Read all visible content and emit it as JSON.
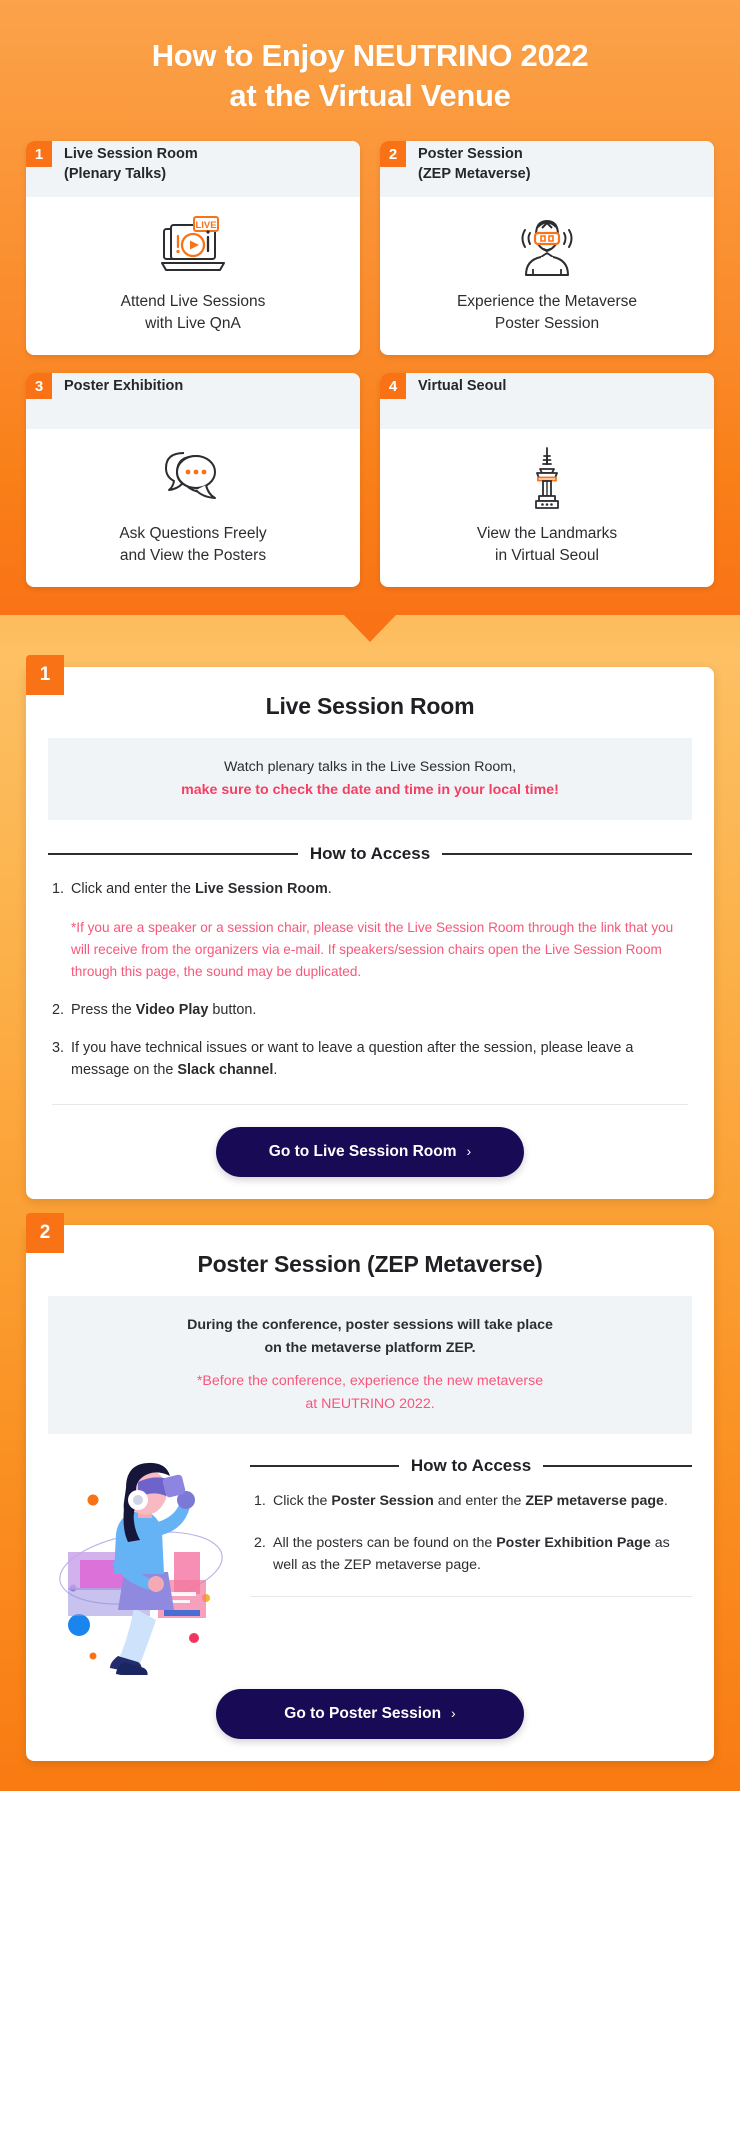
{
  "hero": {
    "title_lines": [
      "How to Enjoy NEUTRINO 2022",
      "at the Virtual Venue"
    ],
    "cards": [
      {
        "number": "1",
        "title_lines": [
          "Live Session Room",
          "(Plenary Talks)"
        ],
        "icon": "live-laptop-icon",
        "icon_label": "LIVE",
        "caption_lines": [
          "Attend Live Sessions",
          "with Live QnA"
        ]
      },
      {
        "number": "2",
        "title_lines": [
          "Poster Session",
          "(ZEP Metaverse)"
        ],
        "icon": "vr-headset-person-icon",
        "caption_lines": [
          "Experience the Metaverse",
          "Poster Session"
        ]
      },
      {
        "number": "3",
        "title_lines": [
          "Poster Exhibition"
        ],
        "icon": "chat-bubbles-icon",
        "caption_lines": [
          "Ask Questions Freely",
          "and View the Posters"
        ]
      },
      {
        "number": "4",
        "title_lines": [
          "Virtual Seoul"
        ],
        "icon": "seoul-tower-icon",
        "caption_lines": [
          "View the Landmarks",
          "in Virtual Seoul"
        ]
      }
    ]
  },
  "sections": [
    {
      "number": "1",
      "title": "Live Session Room",
      "notice": [
        {
          "text": "Watch plenary talks in the Live Session Room,",
          "style": "plain"
        },
        {
          "text": "make sure to check the date and time in your local time!",
          "style": "pink"
        }
      ],
      "how_to_access_label": "How to Access",
      "steps": [
        {
          "num": "1.",
          "parts": [
            {
              "t": "Click and enter the ",
              "b": false
            },
            {
              "t": "Live Session Room",
              "b": true
            },
            {
              "t": ".",
              "b": false
            }
          ],
          "note": "*If you are a speaker or a session chair, please visit the Live Session Room through the link that you will receive from the organizers via e-mail. If speakers/session chairs open the Live Session Room through this page, the sound may be duplicated."
        },
        {
          "num": "2.",
          "parts": [
            {
              "t": "Press the ",
              "b": false
            },
            {
              "t": "Video Play",
              "b": true
            },
            {
              "t": " button.",
              "b": false
            }
          ]
        },
        {
          "num": "3.",
          "parts": [
            {
              "t": "If you have technical issues or want to leave a question after the session, please leave a message on the ",
              "b": false
            },
            {
              "t": "Slack channel",
              "b": true
            },
            {
              "t": ".",
              "b": false
            }
          ]
        }
      ],
      "cta_label": "Go to Live Session Room",
      "cta_chevron": "›"
    },
    {
      "number": "2",
      "title": "Poster Session (ZEP Metaverse)",
      "notice": [
        {
          "text": "During the conference, poster sessions will take place",
          "style": "bold"
        },
        {
          "text": "on the metaverse platform ZEP.",
          "style": "bold"
        },
        {
          "text": "*Before the conference, experience the new metaverse",
          "style": "pink-light"
        },
        {
          "text": "at NEUTRINO 2022.",
          "style": "pink-light"
        }
      ],
      "illustration": "vr-woman-illustration",
      "how_to_access_label": "How to Access",
      "steps": [
        {
          "num": "1.",
          "parts": [
            {
              "t": "Click the ",
              "b": false
            },
            {
              "t": "Poster Session",
              "b": true
            },
            {
              "t": " and enter the ",
              "b": false
            },
            {
              "t": "ZEP metaverse page",
              "b": true
            },
            {
              "t": ".",
              "b": false
            }
          ]
        },
        {
          "num": "2.",
          "parts": [
            {
              "t": "All the posters can be found on the ",
              "b": false
            },
            {
              "t": "Poster Exhibition Page",
              "b": true
            },
            {
              "t": " as well as the ZEP metaverse page.",
              "b": false
            }
          ]
        }
      ],
      "cta_label": "Go to Poster Session",
      "cta_chevron": "›"
    }
  ],
  "colors": {
    "orange": "#f97316",
    "amber": "#fdc064",
    "navy": "#190a56",
    "pink": "#f43f63",
    "pink_light": "#f7577a",
    "panel_gray": "#f1f4f7",
    "text_dark": "#2c2d31"
  }
}
